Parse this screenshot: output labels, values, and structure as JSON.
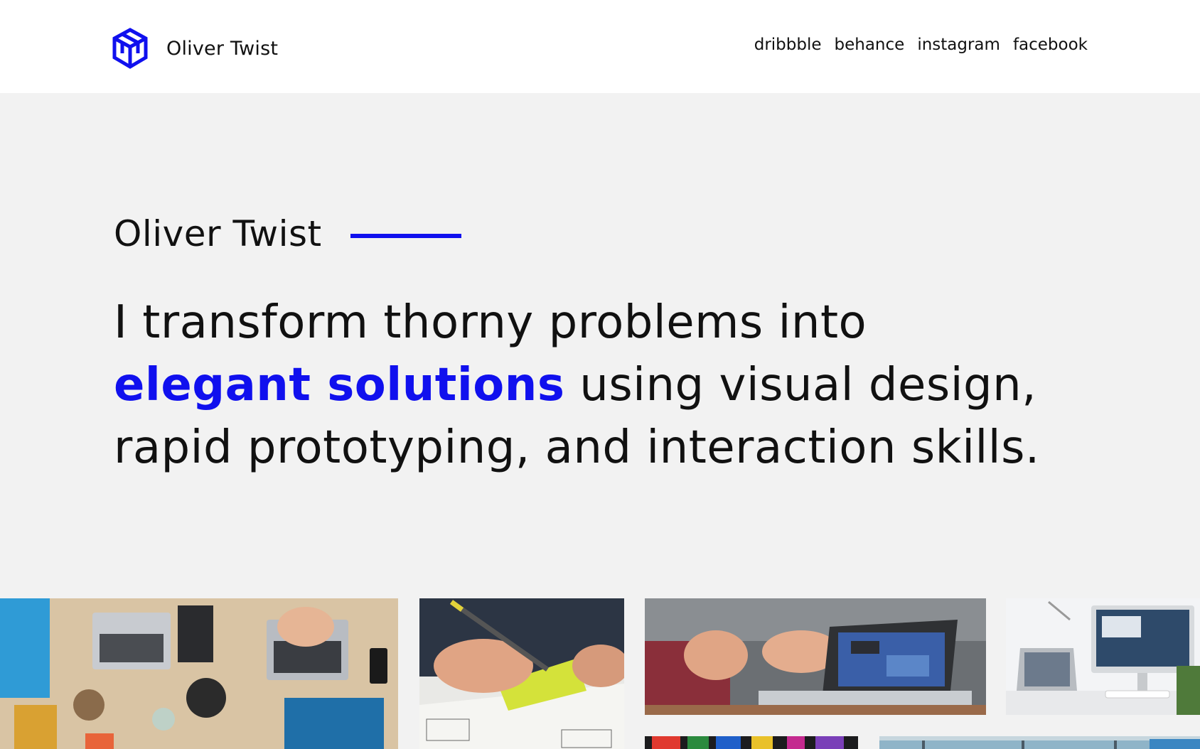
{
  "brand": {
    "name": "Oliver Twist",
    "logo_icon": "isometric-cube-logo-icon"
  },
  "nav": {
    "items": [
      {
        "label": "dribbble"
      },
      {
        "label": "behance"
      },
      {
        "label": "instagram"
      },
      {
        "label": "facebook"
      }
    ]
  },
  "hero": {
    "name": "Oliver Twist",
    "headline_part1": "I transform thorny problems into ",
    "headline_highlight": "elegant solutions",
    "headline_part2": " using visual design, rapid prototyping, and interaction skills."
  },
  "gallery": {
    "images": [
      {
        "subject": "top-down photo of desk with laptops and coffee"
      },
      {
        "subject": "hand holding pencil over yellow sticky note and sketches"
      },
      {
        "subject": "people gesturing in front of laptop"
      },
      {
        "subject": "desktop computer and tablet on white desk"
      },
      {
        "subject": "colorful abstract shapes"
      },
      {
        "subject": "office workspace"
      }
    ]
  },
  "colors": {
    "accent": "#1010ee",
    "header_bg": "#ffffff",
    "page_bg": "#f2f2f2",
    "text": "#111111"
  }
}
